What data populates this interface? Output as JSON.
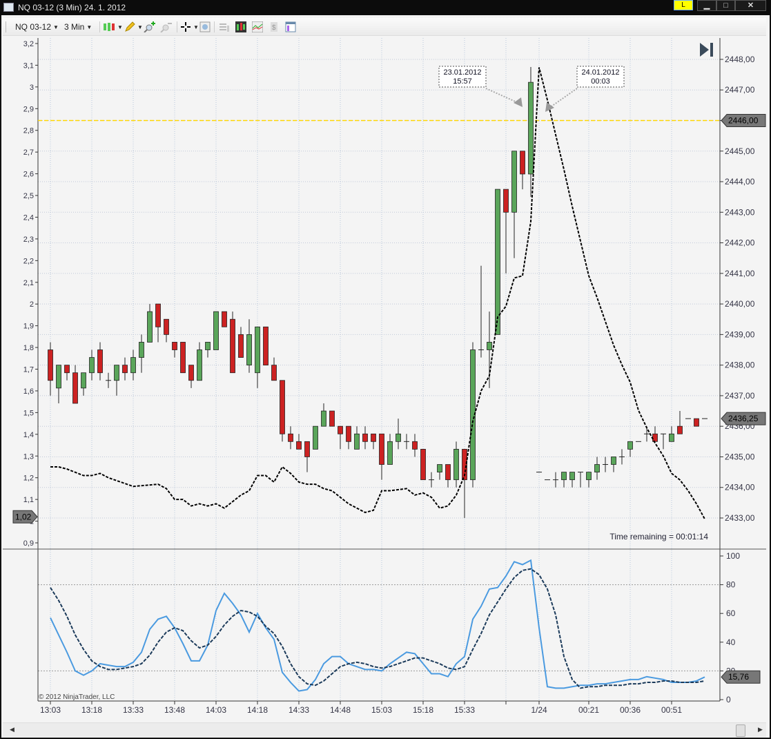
{
  "window": {
    "title": "NQ 03-12 (3 Min)  24. 1. 2012",
    "link_button": "L",
    "minimize": "▁",
    "maximize": "□",
    "close": "✕"
  },
  "toolbar": {
    "instrument": "NQ 03-12",
    "interval": "3 Min",
    "icons": [
      "bar-type-icon",
      "pencil-draw-icon",
      "zoom-in-icon",
      "zoom-out-icon",
      "crosshair-icon",
      "data-box-icon",
      "chart-trader-icon",
      "indicators-icon",
      "strategies-icon",
      "properties-icon",
      "print-icon"
    ]
  },
  "colors": {
    "up": "#5aa55a",
    "down": "#cc2222",
    "hline": "#ffd700",
    "fast": "#4a9ae0",
    "slow": "#1b3a5a"
  },
  "chart_data": {
    "type": "candlestick",
    "price_axis": {
      "min": 2433,
      "max": 2448,
      "ticks": [
        "2433,00",
        "2434,00",
        "2435,00",
        "2436,00",
        "2437,00",
        "2438,00",
        "2439,00",
        "2440,00",
        "2441,00",
        "2442,00",
        "2443,00",
        "2444,00",
        "2445,00",
        "2446,00",
        "2447,00",
        "2448,00"
      ]
    },
    "left_axis": {
      "min": 0.9,
      "max": 3.2,
      "ticks": [
        "0,9",
        "1",
        "1,1",
        "1,2",
        "1,3",
        "1,4",
        "1,5",
        "1,6",
        "1,7",
        "1,8",
        "1,9",
        "2",
        "2,1",
        "2,2",
        "2,3",
        "2,4",
        "2,5",
        "2,6",
        "2,7",
        "2,8",
        "2,9",
        "3",
        "3,1",
        "3,2"
      ]
    },
    "time_ticks": [
      {
        "bar": 0,
        "label": "13:03"
      },
      {
        "bar": 5,
        "label": "13:18"
      },
      {
        "bar": 10,
        "label": "13:33"
      },
      {
        "bar": 15,
        "label": "13:48"
      },
      {
        "bar": 20,
        "label": "14:03"
      },
      {
        "bar": 25,
        "label": "14:18"
      },
      {
        "bar": 30,
        "label": "14:33"
      },
      {
        "bar": 35,
        "label": "14:48"
      },
      {
        "bar": 40,
        "label": "15:03"
      },
      {
        "bar": 45,
        "label": "15:18"
      },
      {
        "bar": 50,
        "label": "15:33"
      },
      {
        "bar": 55,
        "label": ""
      },
      {
        "bar": 59,
        "label": "1/24"
      },
      {
        "bar": 65,
        "label": "00:21"
      },
      {
        "bar": 70,
        "label": "00:36"
      },
      {
        "bar": 75,
        "label": "00:51"
      }
    ],
    "ohlc": [
      [
        2438.5,
        2438.75,
        2437,
        2437.5
      ],
      [
        2437.25,
        2438,
        2436.75,
        2438
      ],
      [
        2438,
        2438,
        2437.5,
        2437.75
      ],
      [
        2437.75,
        2438,
        2436.75,
        2436.75
      ],
      [
        2437.25,
        2437.75,
        2437,
        2437.75
      ],
      [
        2437.75,
        2438.5,
        2437.5,
        2438.25
      ],
      [
        2438.5,
        2438.75,
        2437.5,
        2437.75
      ],
      [
        2437.5,
        2437.75,
        2437.25,
        2437.5
      ],
      [
        2437.5,
        2438,
        2437,
        2438
      ],
      [
        2438,
        2438.25,
        2437.5,
        2437.75
      ],
      [
        2437.75,
        2438.5,
        2437.5,
        2438.25
      ],
      [
        2438.25,
        2439,
        2437.75,
        2438.75
      ],
      [
        2438.75,
        2440,
        2438.75,
        2439.75
      ],
      [
        2440,
        2440,
        2438.75,
        2439.25
      ],
      [
        2439.5,
        2439.5,
        2438.75,
        2439
      ],
      [
        2438.75,
        2438.75,
        2438.25,
        2438.5
      ],
      [
        2438.75,
        2438.75,
        2437.75,
        2437.75
      ],
      [
        2438,
        2438,
        2437.25,
        2437.5
      ],
      [
        2437.5,
        2438.75,
        2437.5,
        2438.5
      ],
      [
        2438.5,
        2438.75,
        2438.25,
        2438.75
      ],
      [
        2438.5,
        2439.75,
        2438.5,
        2439.75
      ],
      [
        2439.75,
        2439.75,
        2439.25,
        2439.25
      ],
      [
        2439.5,
        2439.75,
        2437.75,
        2437.75
      ],
      [
        2439,
        2439.25,
        2438.25,
        2438.25
      ],
      [
        2438,
        2439.5,
        2437.75,
        2439
      ],
      [
        2437.75,
        2439.25,
        2437.25,
        2439.25
      ],
      [
        2439.25,
        2439.25,
        2438,
        2438
      ],
      [
        2438,
        2438.25,
        2437.5,
        2437.5
      ],
      [
        2437.5,
        2437.5,
        2435.5,
        2435.75
      ],
      [
        2435.75,
        2436,
        2435.25,
        2435.5
      ],
      [
        2435.5,
        2435.75,
        2435.25,
        2435.25
      ],
      [
        2435.5,
        2435.5,
        2434.5,
        2435
      ],
      [
        2435.25,
        2436,
        2435.25,
        2436
      ],
      [
        2436,
        2436.75,
        2436,
        2436.5
      ],
      [
        2436.5,
        2436.5,
        2436,
        2436
      ],
      [
        2436,
        2436,
        2435.25,
        2435.75
      ],
      [
        2436,
        2436,
        2435.25,
        2435.5
      ],
      [
        2435.25,
        2436,
        2435.25,
        2435.75
      ],
      [
        2435.75,
        2436,
        2435.25,
        2435.5
      ],
      [
        2435.75,
        2435.75,
        2435.25,
        2435.5
      ],
      [
        2435.75,
        2435.75,
        2434.25,
        2434.75
      ],
      [
        2434.75,
        2435.75,
        2434.75,
        2435.5
      ],
      [
        2435.5,
        2436.25,
        2435.25,
        2435.75
      ],
      [
        2435.5,
        2435.75,
        2435.25,
        2435.5
      ],
      [
        2435.5,
        2435.75,
        2435,
        2435.25
      ],
      [
        2435.25,
        2435.25,
        2434.25,
        2434.25
      ],
      [
        2434.25,
        2434.5,
        2434,
        2434.25
      ],
      [
        2434.5,
        2434.75,
        2434.25,
        2434.75
      ],
      [
        2434.75,
        2434.75,
        2434,
        2434.25
      ],
      [
        2434.25,
        2435.5,
        2434,
        2435.25
      ],
      [
        2435.25,
        2435.25,
        2433,
        2434.25
      ],
      [
        2434.25,
        2438.75,
        2434,
        2438.5
      ],
      [
        2438.5,
        2441.25,
        2438.25,
        2438.5
      ],
      [
        2438.5,
        2439.75,
        2437.25,
        2438.75
      ],
      [
        2439,
        2443.75,
        2439,
        2443.75
      ],
      [
        2443.75,
        2443.75,
        2441,
        2443
      ],
      [
        2443,
        2445,
        2441.5,
        2445
      ],
      [
        2445,
        2445,
        2443.75,
        2444.25
      ],
      [
        2444.25,
        2447.75,
        2443.5,
        2447.25
      ],
      [
        2434.5,
        2434.5,
        2434.5,
        2434.5
      ],
      [
        2434.25,
        2434.25,
        2434.25,
        2434.25
      ],
      [
        2434.25,
        2434.5,
        2434,
        2434.25
      ],
      [
        2434.25,
        2434.5,
        2434,
        2434.5
      ],
      [
        2434.25,
        2434.5,
        2434,
        2434.5
      ],
      [
        2434.5,
        2434.5,
        2434,
        2434.5
      ],
      [
        2434.25,
        2434.5,
        2434,
        2434.5
      ],
      [
        2434.5,
        2435,
        2434.25,
        2434.75
      ],
      [
        2434.75,
        2435,
        2434.5,
        2434.75
      ],
      [
        2434.75,
        2435,
        2434.5,
        2435
      ],
      [
        2435,
        2435.25,
        2434.75,
        2435
      ],
      [
        2435.25,
        2435.5,
        2435,
        2435.5
      ],
      [
        2435.5,
        2435.5,
        2435.5,
        2435.5
      ],
      [
        2435.75,
        2436,
        2435.5,
        2435.75
      ],
      [
        2435.75,
        2436,
        2435.5,
        2435.5
      ],
      [
        2435.75,
        2435.75,
        2435.25,
        2435.75
      ],
      [
        2435.5,
        2436,
        2435.5,
        2435.75
      ],
      [
        2436,
        2436.5,
        2435.75,
        2435.75
      ],
      [
        2436.25,
        2436.25,
        2436.25,
        2436.25
      ],
      [
        2436.25,
        2436.25,
        2436,
        2436
      ],
      [
        2436.25,
        2436.25,
        2436.25,
        2436.25
      ]
    ],
    "left_series": [
      [
        0,
        1.25
      ],
      [
        1,
        1.25
      ],
      [
        2,
        1.24
      ],
      [
        4,
        1.21
      ],
      [
        5,
        1.21
      ],
      [
        6,
        1.22
      ],
      [
        7,
        1.2
      ],
      [
        10,
        1.16
      ],
      [
        13,
        1.17
      ],
      [
        14,
        1.15
      ],
      [
        15,
        1.1
      ],
      [
        16,
        1.1
      ],
      [
        17,
        1.07
      ],
      [
        18,
        1.08
      ],
      [
        19,
        1.07
      ],
      [
        20,
        1.08
      ],
      [
        21,
        1.06
      ],
      [
        23,
        1.12
      ],
      [
        24,
        1.14
      ],
      [
        25,
        1.21
      ],
      [
        26,
        1.21
      ],
      [
        27,
        1.18
      ],
      [
        28,
        1.25
      ],
      [
        29,
        1.22
      ],
      [
        30,
        1.18
      ],
      [
        31,
        1.17
      ],
      [
        32,
        1.17
      ],
      [
        33,
        1.15
      ],
      [
        34,
        1.14
      ],
      [
        35,
        1.11
      ],
      [
        36,
        1.08
      ],
      [
        37,
        1.06
      ],
      [
        38,
        1.04
      ],
      [
        39,
        1.05
      ],
      [
        40,
        1.14
      ],
      [
        41,
        1.14
      ],
      [
        43,
        1.15
      ],
      [
        44,
        1.12
      ],
      [
        45,
        1.13
      ],
      [
        46,
        1.11
      ],
      [
        47,
        1.06
      ],
      [
        48,
        1.07
      ],
      [
        49,
        1.12
      ],
      [
        50,
        1.21
      ],
      [
        51,
        1.46
      ],
      [
        52,
        1.6
      ],
      [
        53,
        1.67
      ],
      [
        54,
        1.94
      ],
      [
        55,
        1.99
      ],
      [
        56,
        2.12
      ],
      [
        57,
        2.13
      ],
      [
        58,
        2.38
      ],
      [
        59,
        3.09
      ],
      [
        60,
        2.94
      ],
      [
        61,
        2.78
      ],
      [
        62,
        2.62
      ],
      [
        63,
        2.45
      ],
      [
        64,
        2.29
      ],
      [
        65,
        2.13
      ],
      [
        66,
        2.03
      ],
      [
        67,
        1.92
      ],
      [
        68,
        1.81
      ],
      [
        69,
        1.72
      ],
      [
        70,
        1.64
      ],
      [
        71,
        1.51
      ],
      [
        72,
        1.43
      ],
      [
        73,
        1.36
      ],
      [
        74,
        1.3
      ],
      [
        75,
        1.22
      ],
      [
        76,
        1.19
      ],
      [
        77,
        1.14
      ],
      [
        78,
        1.08
      ],
      [
        79,
        1.01
      ]
    ],
    "horizontal_line": 2446,
    "tags": {
      "left_value": "1,02",
      "hline_value": "2446,00",
      "last_price": "2436,25",
      "osc_value": "15,76"
    },
    "last_price": 2436.25,
    "left_value": 1.02,
    "annotations": [
      {
        "date": "23.01.2012",
        "time": "15:57",
        "bar": 58
      },
      {
        "date": "24.01.2012",
        "time": "00:03",
        "bar": 59
      }
    ],
    "time_remaining": "Time remaining = 00:01:14",
    "copyright": "© 2012 NinjaTrader, LLC",
    "oscillator": {
      "min": 0,
      "max": 100,
      "ticks": [
        "0",
        "20",
        "40",
        "60",
        "80",
        "100"
      ],
      "levels": [
        20,
        80
      ],
      "value": 15.76,
      "fast": [
        57,
        45,
        33,
        20,
        17,
        20,
        25,
        24,
        23,
        23,
        26,
        33,
        49,
        56,
        58,
        50,
        39,
        27,
        27,
        38,
        62,
        74,
        67,
        59,
        47,
        60,
        50,
        42,
        19,
        12,
        6,
        7,
        14,
        25,
        30,
        30,
        25,
        23,
        21,
        21,
        20,
        25,
        29,
        33,
        32,
        25,
        18,
        18,
        16,
        25,
        30,
        56,
        65,
        77,
        78,
        86,
        96,
        94,
        97,
        50,
        9,
        8,
        8,
        9,
        10,
        10,
        11,
        11,
        12,
        13,
        14,
        14,
        16,
        15,
        14,
        12,
        12,
        12,
        13,
        15.76
      ],
      "slow": [
        78,
        69,
        58,
        45,
        35,
        27,
        23,
        21,
        21,
        22,
        23,
        25,
        31,
        40,
        47,
        50,
        48,
        41,
        36,
        38,
        44,
        52,
        58,
        62,
        61,
        58,
        51,
        46,
        37,
        25,
        16,
        11,
        10,
        13,
        18,
        23,
        25,
        26,
        25,
        23,
        22,
        23,
        25,
        27,
        29,
        29,
        27,
        25,
        22,
        21,
        23,
        35,
        46,
        59,
        68,
        77,
        85,
        90,
        91,
        87,
        77,
        59,
        30,
        14,
        8,
        9,
        9,
        10,
        10,
        10,
        11,
        11,
        12,
        12,
        13,
        13,
        12,
        12,
        12,
        13
      ]
    }
  }
}
